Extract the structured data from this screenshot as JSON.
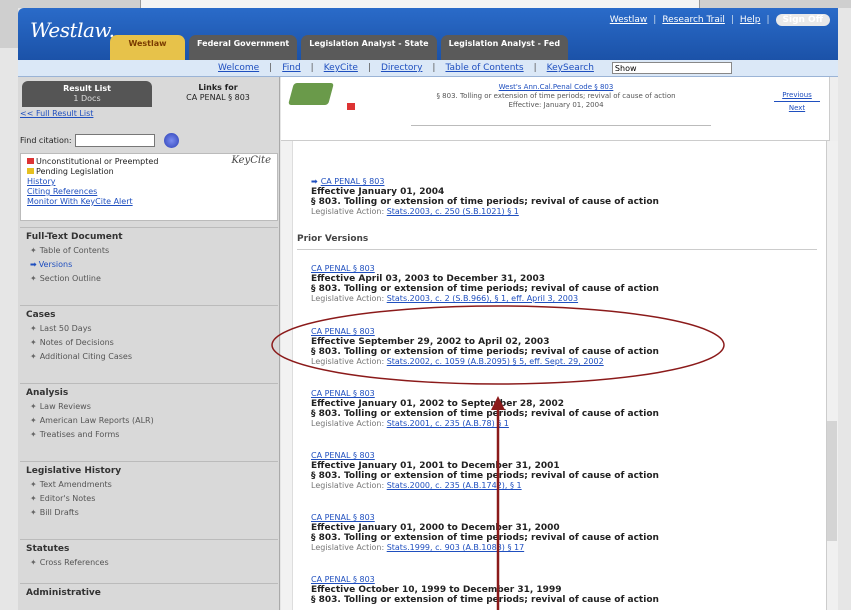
{
  "header": {
    "logo": "Westlaw.",
    "top_links": [
      "Westlaw",
      "Research Trail",
      "Help",
      "Sign Off"
    ],
    "tabs": [
      {
        "label": "Westlaw",
        "active": true
      },
      {
        "label": "Federal Government",
        "active": false
      },
      {
        "label": "Legislation Analyst - State",
        "active": false
      },
      {
        "label": "Legislation Analyst - Fed",
        "active": false
      }
    ]
  },
  "subnav": {
    "links": [
      "Welcome",
      "Find",
      "KeyCite",
      "Directory",
      "Table of Contents",
      "KeySearch"
    ],
    "search_value": "Show"
  },
  "sidebar": {
    "result_list_title": "Result List",
    "result_list_sub": "1 Docs",
    "links_for_title": "Links for",
    "links_for_value": "CA PENAL § 803",
    "full_result": "<< Full Result List",
    "find_label": "Find citation:",
    "keycite": {
      "logo": "KeyCite",
      "items": [
        "Unconstitutional or Preempted",
        "Pending Legislation",
        "History",
        "Citing References",
        "Monitor With KeyCite Alert"
      ]
    },
    "sections": [
      {
        "title": "Full-Text Document",
        "items": [
          "Table of Contents",
          "Versions",
          "Section Outline"
        ]
      },
      {
        "title": "Cases",
        "items": [
          "Last 50 Days",
          "Notes of Decisions",
          "Additional Citing Cases"
        ]
      },
      {
        "title": "Analysis",
        "items": [
          "Law Reviews",
          "American Law Reports (ALR)",
          "Treatises and Forms"
        ]
      },
      {
        "title": "Legislative History",
        "items": [
          "Text Amendments",
          "Editor's Notes",
          "Bill Drafts"
        ]
      },
      {
        "title": "Statutes",
        "items": [
          "Cross References"
        ]
      },
      {
        "title": "Administrative",
        "items": []
      }
    ]
  },
  "main": {
    "doc_title_link": "West's Ann.Cal.Penal Code § 803",
    "doc_title_line2": "§ 803. Tolling or extension of time periods; revival of cause of action",
    "doc_title_line3": "Effective: January 01, 2004",
    "prev_next": [
      "Previous",
      "Next"
    ],
    "current": {
      "cite": "CA PENAL § 803",
      "effective": "Effective January 01, 2004",
      "section": "§ 803. Tolling or extension of time periods; revival of cause of action",
      "la_label": "Legislative Action:",
      "la_link": "Stats.2003, c. 250 (S.B.1021) § 1"
    },
    "prior_title": "Prior Versions",
    "versions": [
      {
        "cite": "CA PENAL § 803",
        "effective": "Effective April 03, 2003 to December 31, 2003",
        "section": "§ 803. Tolling or extension of time periods; revival of cause of action",
        "la_label": "Legislative Action:",
        "la_link": "Stats.2003, c. 2 (S.B.966), § 1, eff. April 3, 2003"
      },
      {
        "cite": "CA PENAL § 803",
        "effective": "Effective September 29, 2002 to April 02, 2003",
        "section": "§ 803. Tolling or extension of time periods; revival of cause of action",
        "la_label": "Legislative Action:",
        "la_link": "Stats.2002, c. 1059 (A.B.2095) § 5, eff. Sept. 29, 2002"
      },
      {
        "cite": "CA PENAL § 803",
        "effective": "Effective January 01, 2002 to September 28, 2002",
        "section": "§ 803. Tolling or extension of time periods; revival of cause of action",
        "la_label": "Legislative Action:",
        "la_link": "Stats.2001, c. 235 (A.B.78) § 1"
      },
      {
        "cite": "CA PENAL § 803",
        "effective": "Effective January 01, 2001 to December 31, 2001",
        "section": "§ 803. Tolling or extension of time periods; revival of cause of action",
        "la_label": "Legislative Action:",
        "la_link": "Stats.2000, c. 235 (A.B.1742), § 1"
      },
      {
        "cite": "CA PENAL § 803",
        "effective": "Effective January 01, 2000 to December 31, 2000",
        "section": "§ 803. Tolling or extension of time periods; revival of cause of action",
        "la_label": "Legislative Action:",
        "la_link": "Stats.1999, c. 903 (A.B.1083) § 17"
      },
      {
        "cite": "CA PENAL § 803",
        "effective": "Effective October 10, 1999 to December 31, 1999",
        "section": "§ 803. Tolling or extension of time periods; revival of cause of action",
        "la_label": "",
        "la_link": ""
      }
    ]
  },
  "colors": {
    "brand": "#1b52a8",
    "active_tab": "#e7c24a",
    "annotation": "#8b1a1a",
    "link": "#1f4fbf"
  }
}
